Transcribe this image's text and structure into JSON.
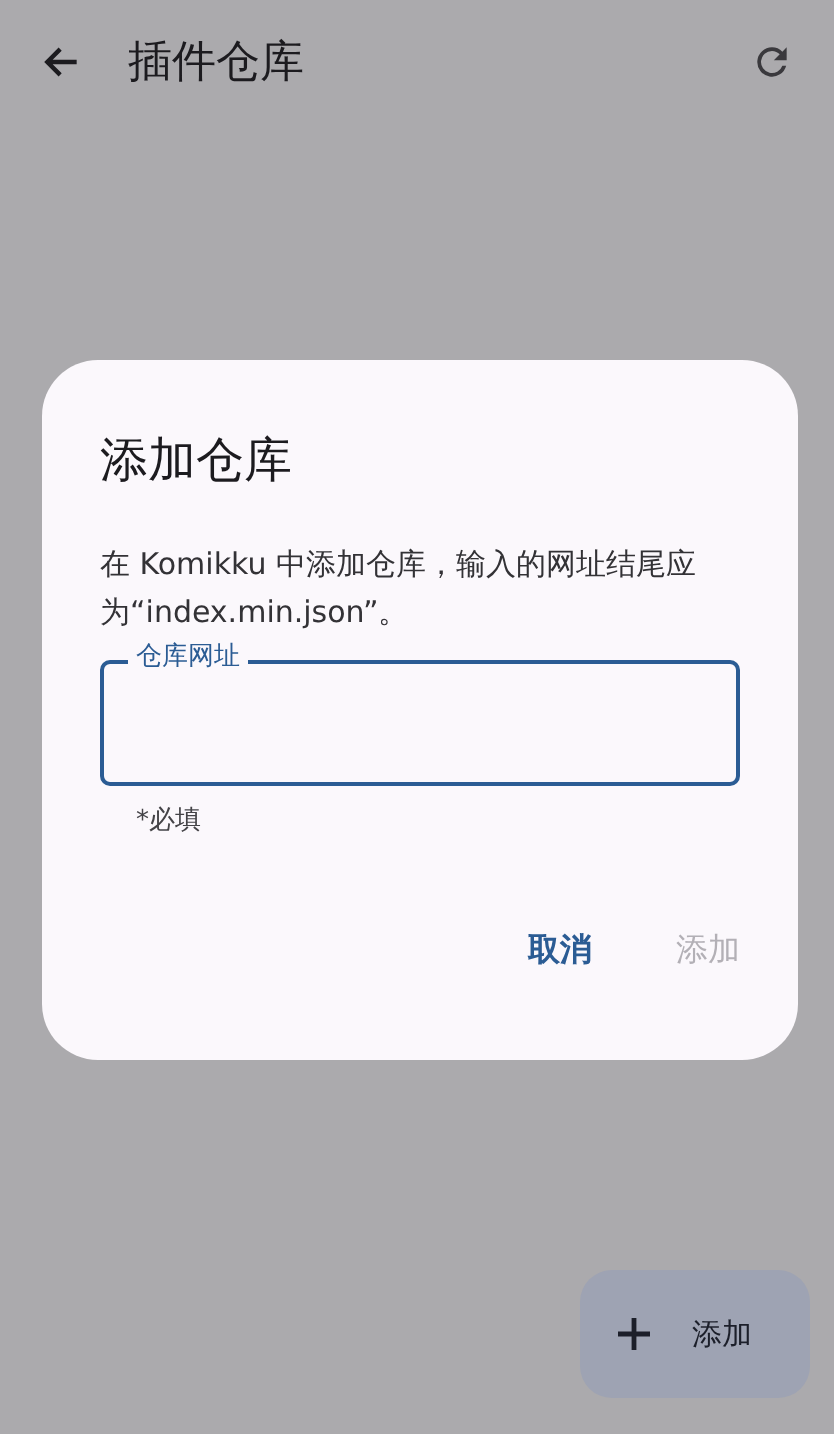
{
  "app_bar": {
    "title": "插件仓库"
  },
  "dialog": {
    "title": "添加仓库",
    "message": "在 Komikku 中添加仓库，输入的网址结尾应为“index.min.json”。",
    "field": {
      "label": "仓库网址",
      "helper": "*必填"
    },
    "buttons": [
      {
        "label": "取消",
        "disabled": false
      },
      {
        "label": "添加",
        "disabled": true
      }
    ]
  },
  "fab": {
    "label": "添加"
  }
}
